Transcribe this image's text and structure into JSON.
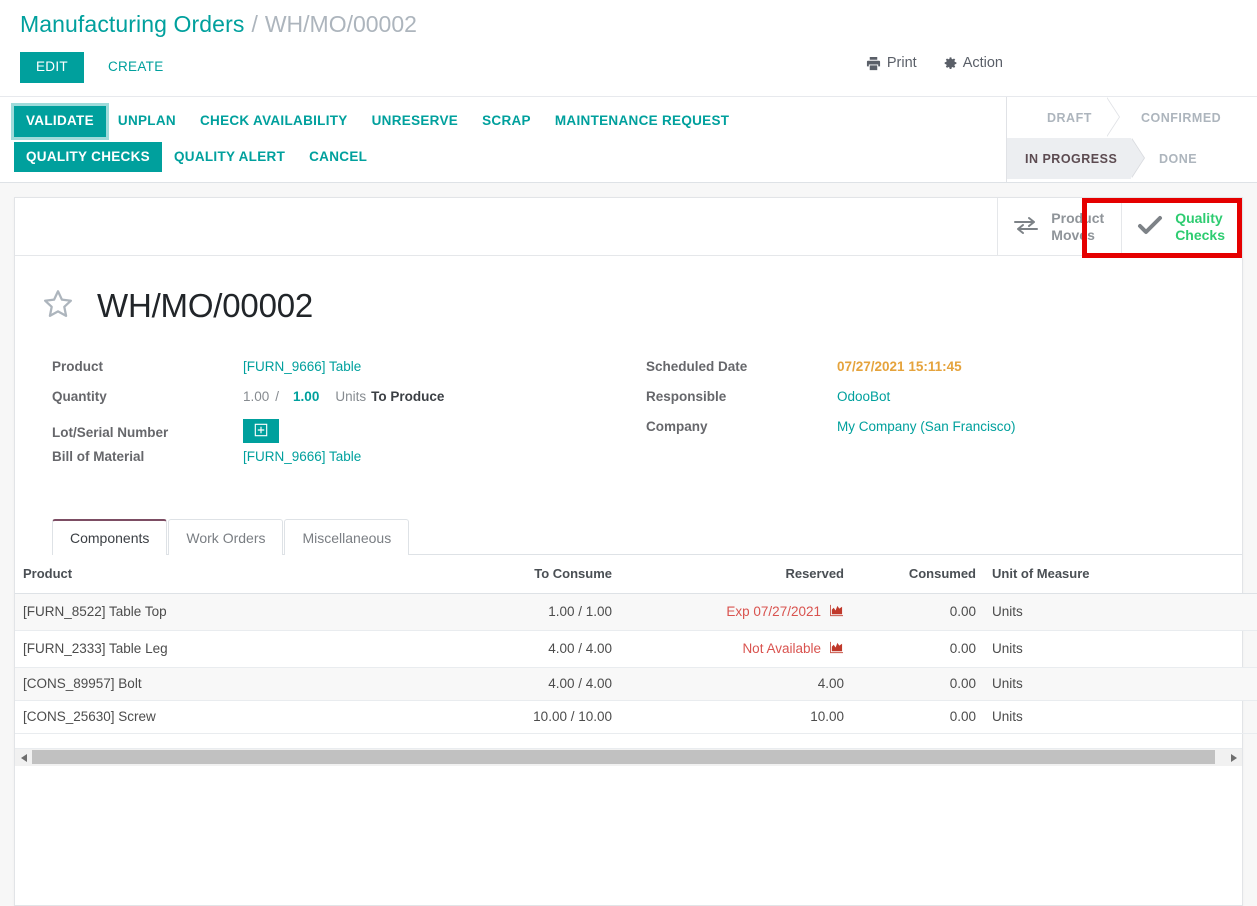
{
  "breadcrumb": {
    "root": "Manufacturing Orders",
    "separator": "/",
    "current": "WH/MO/00002"
  },
  "control_panel": {
    "edit_label": "EDIT",
    "create_label": "CREATE",
    "print_label": "Print",
    "print_icon": "printer-icon",
    "action_label": "Action",
    "action_icon": "gear-icon"
  },
  "statusbar": {
    "buttons_row1": [
      {
        "label": "VALIDATE",
        "style": "primary",
        "focused": true
      },
      {
        "label": "UNPLAN",
        "style": "link",
        "focused": false
      },
      {
        "label": "CHECK AVAILABILITY",
        "style": "link",
        "focused": false
      },
      {
        "label": "UNRESERVE",
        "style": "link",
        "focused": false
      },
      {
        "label": "SCRAP",
        "style": "link",
        "focused": false
      },
      {
        "label": "MAINTENANCE REQUEST",
        "style": "link",
        "focused": false
      }
    ],
    "buttons_row2": [
      {
        "label": "QUALITY CHECKS",
        "style": "primary",
        "focused": false
      },
      {
        "label": "QUALITY ALERT",
        "style": "link",
        "focused": false
      },
      {
        "label": "CANCEL",
        "style": "link",
        "focused": false
      }
    ],
    "stages": [
      {
        "label": "DRAFT",
        "active": false
      },
      {
        "label": "CONFIRMED",
        "active": false
      },
      {
        "label": "IN PROGRESS",
        "active": true
      },
      {
        "label": "DONE",
        "active": false
      }
    ]
  },
  "smart_buttons": [
    {
      "label": "Product\nMoves",
      "icon": "exchange-arrows-icon",
      "color_class": "gray",
      "highlighted": false
    },
    {
      "label": "Quality\nChecks",
      "icon": "check-icon",
      "color_class": "green",
      "highlighted": true
    }
  ],
  "record": {
    "favorite_icon": "star-outline-icon",
    "title": "WH/MO/00002",
    "left_fields": [
      {
        "label": "Product",
        "value": "[FURN_9666] Table",
        "kind": "link"
      },
      {
        "label": "Quantity",
        "kind": "quantity"
      },
      {
        "label": "Lot/Serial Number",
        "kind": "button",
        "button_icon": "plus-square-icon"
      },
      {
        "label": "Bill of Material",
        "value": "[FURN_9666] Table",
        "kind": "link"
      }
    ],
    "quantity": {
      "done": "1.00",
      "slash": "/",
      "to_produce_qty": "1.00",
      "uom": "Units",
      "state": "To Produce"
    },
    "right_fields": [
      {
        "label": "Scheduled Date",
        "value": "07/27/2021 15:11:45",
        "kind": "warn"
      },
      {
        "label": "Responsible",
        "value": "OdooBot",
        "kind": "link"
      },
      {
        "label": "Company",
        "value": "My Company (San Francisco)",
        "kind": "link"
      }
    ]
  },
  "notebook": {
    "tabs": [
      {
        "label": "Components",
        "active": true
      },
      {
        "label": "Work Orders",
        "active": false
      },
      {
        "label": "Miscellaneous",
        "active": false
      }
    ],
    "optional_columns_icon": "vertical-ellipsis-icon"
  },
  "components_table": {
    "columns": [
      "Product",
      "To Consume",
      "Reserved",
      "Consumed",
      "Unit of Measure"
    ],
    "rows": [
      {
        "product": "[FURN_8522] Table Top",
        "to_consume": "1.00 / 1.00",
        "reserved": "Exp 07/27/2021",
        "reserved_warning": true,
        "reserved_icon": "forecast-chart-icon",
        "consumed": "0.00",
        "uom": "Units",
        "action_icon": "detailed-operations-icon",
        "has_action": true
      },
      {
        "product": "[FURN_2333] Table Leg",
        "to_consume": "4.00 / 4.00",
        "reserved": "Not Available",
        "reserved_warning": true,
        "reserved_icon": "forecast-chart-icon",
        "consumed": "0.00",
        "uom": "Units",
        "action_icon": "detailed-operations-icon",
        "has_action": true
      },
      {
        "product": "[CONS_89957] Bolt",
        "to_consume": "4.00 / 4.00",
        "reserved": "4.00",
        "reserved_warning": false,
        "consumed": "0.00",
        "uom": "Units",
        "has_action": false
      },
      {
        "product": "[CONS_25630] Screw",
        "to_consume": "10.00 / 10.00",
        "reserved": "10.00",
        "reserved_warning": false,
        "consumed": "0.00",
        "uom": "Units",
        "has_action": false
      }
    ]
  },
  "scrollbar": {
    "left_arrow_icon": "triangle-left-icon",
    "right_arrow_icon": "triangle-right-icon"
  },
  "colors": {
    "primary": "#00a09d",
    "warning": "#e5a33c",
    "danger": "#d9534f",
    "success": "#2ecc71",
    "annotation": "#e50000",
    "muted": "#adb5bd"
  }
}
